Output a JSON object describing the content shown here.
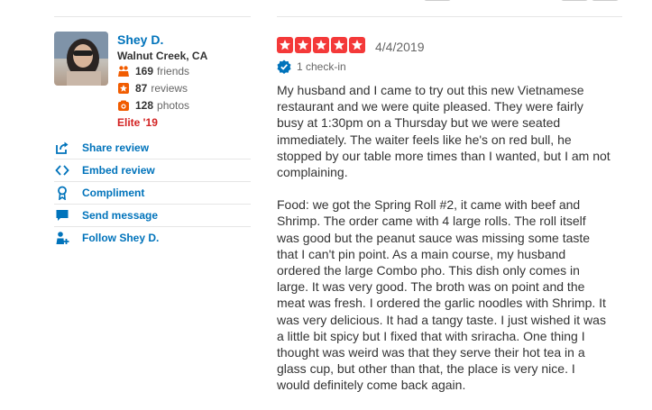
{
  "user": {
    "name": "Shey D.",
    "location": "Walnut Creek, CA",
    "friends_count": "169",
    "friends_label": "friends",
    "reviews_count": "87",
    "reviews_label": "reviews",
    "photos_count": "128",
    "photos_label": "photos",
    "elite": "Elite '19"
  },
  "actions": [
    {
      "label": "Share review",
      "icon": "share-icon"
    },
    {
      "label": "Embed review",
      "icon": "embed-icon"
    },
    {
      "label": "Compliment",
      "icon": "award-icon"
    },
    {
      "label": "Send message",
      "icon": "message-icon"
    },
    {
      "label": "Follow Shey D.",
      "icon": "follow-icon"
    }
  ],
  "review": {
    "rating": 5,
    "rating_max": 5,
    "date": "4/4/2019",
    "checkin": "1 check-in",
    "paragraphs": [
      "My husband and I came to try out this new Vietnamese restaurant and we were quite pleased. They were fairly busy at 1:30pm on a Thursday but we were seated immediately. The waiter feels like he's on red bull, he stopped by our table more times than I wanted, but I am not complaining.",
      "Food: we got the Spring Roll #2, it came with beef and Shrimp. The order came with 4 large rolls. The roll itself was good but the peanut sauce was missing some taste that I can't pin point. As a main course, my husband ordered the large Combo pho. This dish only comes in large. It was very good. The broth was on point and the meat was fresh. I ordered the garlic noodles with Shrimp. It was very delicious. It had a tangy taste. I just wished it was a little bit spicy but I fixed that with sriracha. One thing I thought was weird was that they serve their hot tea in a glass cup, but other than that, the place is very nice. I would definitely come back again."
    ]
  },
  "colors": {
    "link": "#0073bb",
    "star": "#f43939",
    "elite": "#d32323",
    "stat_icon": "#f15c00",
    "checkin_badge": "#0073bb"
  }
}
